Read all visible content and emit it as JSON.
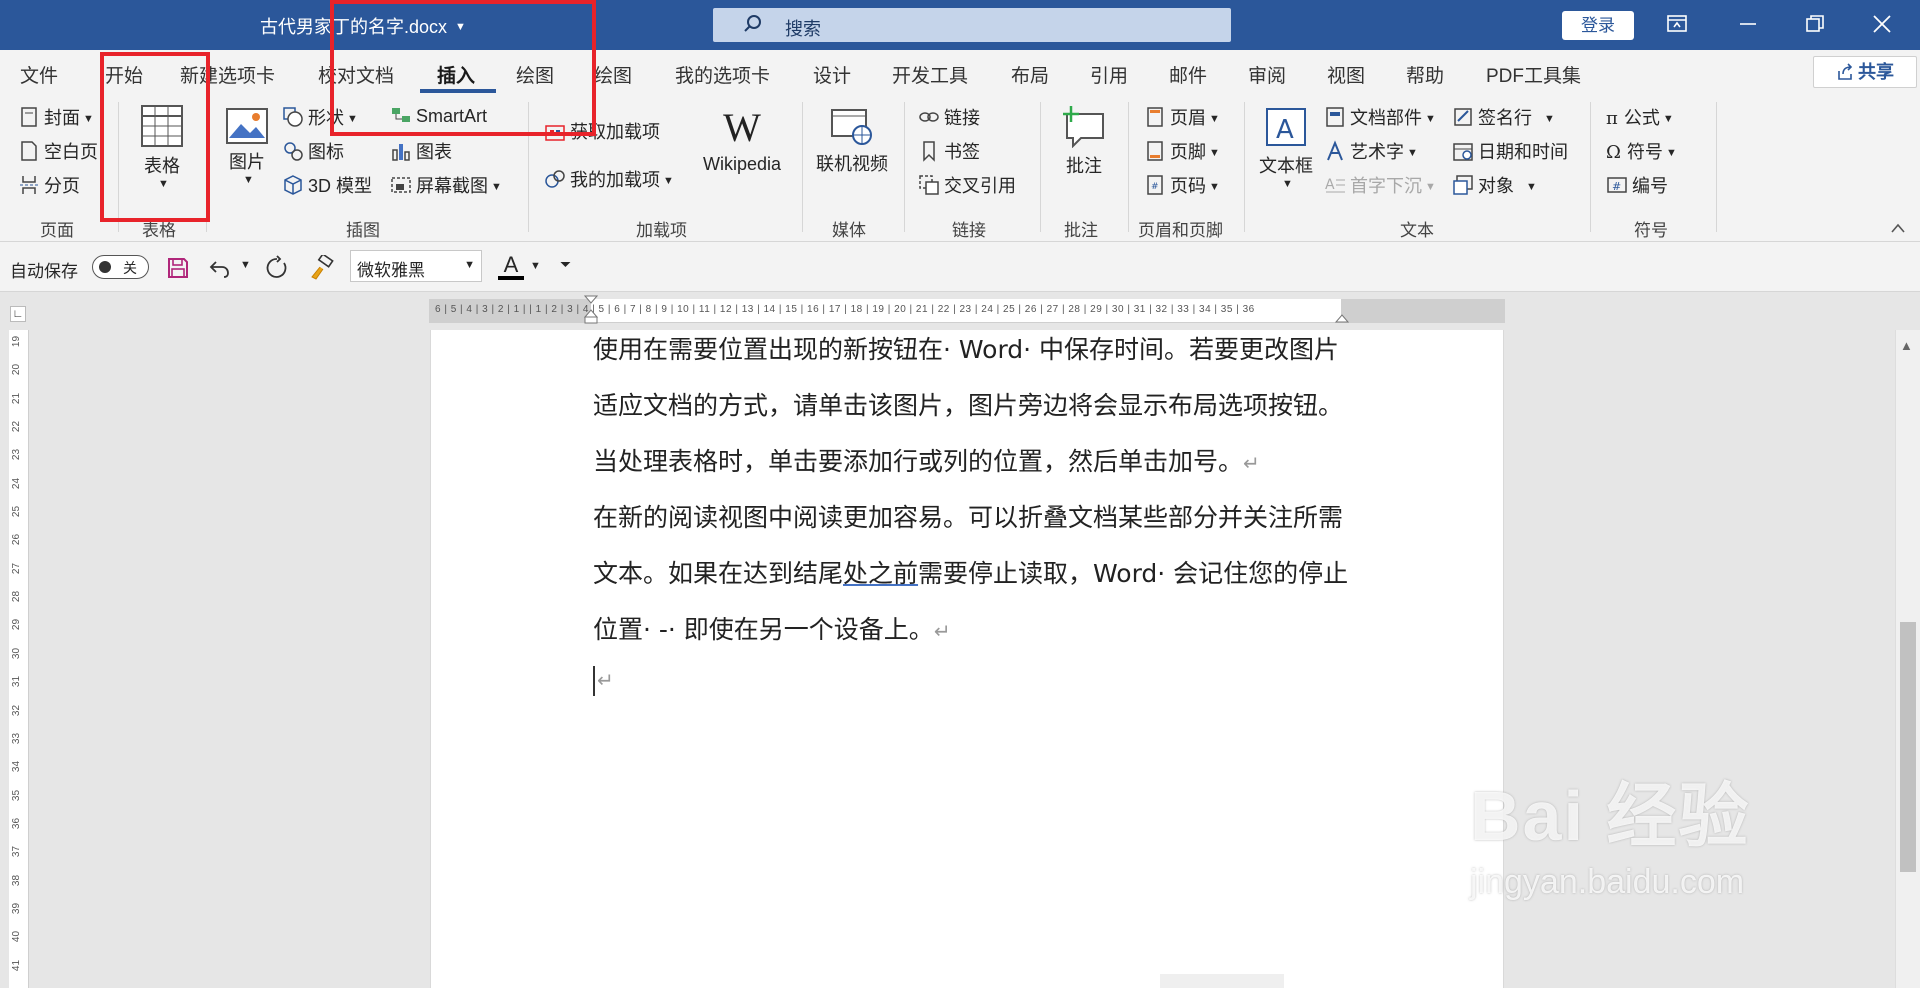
{
  "titlebar": {
    "doc_title": "古代男家丁的名字.docx",
    "search_placeholder": "搜索",
    "login_label": "登录"
  },
  "tabs": [
    {
      "label": "文件"
    },
    {
      "label": "开始"
    },
    {
      "label": "新建选项卡"
    },
    {
      "label": "校对文档"
    },
    {
      "label": "插入",
      "active": true
    },
    {
      "label": "绘图"
    },
    {
      "label": "绘图"
    },
    {
      "label": "我的选项卡"
    },
    {
      "label": "设计"
    },
    {
      "label": "开发工具"
    },
    {
      "label": "布局"
    },
    {
      "label": "引用"
    },
    {
      "label": "邮件"
    },
    {
      "label": "审阅"
    },
    {
      "label": "视图"
    },
    {
      "label": "帮助"
    },
    {
      "label": "PDF工具集"
    }
  ],
  "share_label": "共享",
  "ribbon": {
    "pages": {
      "cover": "封面",
      "blank": "空白页",
      "break": "分页",
      "group": "页面"
    },
    "tables": {
      "table": "表格",
      "group": "表格"
    },
    "illustrations": {
      "picture": "图片",
      "shapes": "形状",
      "icons": "图标",
      "model3d": "3D 模型",
      "smartart": "SmartArt",
      "chart": "图表",
      "screenshot": "屏幕截图",
      "group": "插图"
    },
    "addins": {
      "get": "获取加载项",
      "my": "我的加载项",
      "wikipedia": "Wikipedia",
      "group": "加载项"
    },
    "media": {
      "video": "联机视频",
      "group": "媒体"
    },
    "links": {
      "link": "链接",
      "bookmark": "书签",
      "crossref": "交叉引用",
      "group": "链接"
    },
    "comments": {
      "comment": "批注",
      "group": "批注"
    },
    "headerfooter": {
      "header": "页眉",
      "footer": "页脚",
      "pagenum": "页码",
      "group": "页眉和页脚"
    },
    "text": {
      "textbox": "文本框",
      "parts": "文档部件",
      "wordart": "艺术字",
      "dropcap": "首字下沉",
      "sigline": "签名行",
      "datetime": "日期和时间",
      "object": "对象",
      "group": "文本"
    },
    "symbols": {
      "equation": "公式",
      "symbol": "符号",
      "number": "编号",
      "group": "符号"
    }
  },
  "qat": {
    "autosave": "自动保存",
    "autosave_state": "关",
    "font": "微软雅黑",
    "font_color_label": "A"
  },
  "ruler_numbers": "6 | 5 | 4 | 3 | 2 | 1 |   | 1 | 2 | 3 | 4 | 5 | 6 | 7 | 8 | 9 | 10 | 11 | 12 | 13 | 14 | 15 | 16 | 17 | 18 | 19 | 20 | 21 | 22 | 23 | 24 | 25 | 26 | 27 | 28 | 29 | 30 | 31 | 32 | 33 | 34 | 35 | 36",
  "vruler_numbers": [
    "19",
    "20",
    "21",
    "22",
    "23",
    "24",
    "25",
    "26",
    "27",
    "28",
    "29",
    "30",
    "31",
    "32",
    "33",
    "34",
    "35",
    "36",
    "37",
    "38",
    "39",
    "40",
    "41"
  ],
  "document": {
    "line1": "使用在需要位置出现的新按钮在· Word· 中保存时间。若要更改图片",
    "line2": "适应文档的方式，请单击该图片，图片旁边将会显示布局选项按钮。",
    "line3": "当处理表格时，单击要添加行或列的位置，然后单击加号。",
    "line4": "在新的阅读视图中阅读更加容易。可以折叠文档某些部分并关注所需",
    "line5a": "文本。如果在达到结尾",
    "line5u": "处之前",
    "line5b": "需要停止读取，Word· 会记住您的停止",
    "line6": "位置· -· 即使在另一个设备上。",
    "para_mark": "↵"
  },
  "watermark": {
    "main": "Bai 经验",
    "sub": "jingyan.baidu.com"
  }
}
